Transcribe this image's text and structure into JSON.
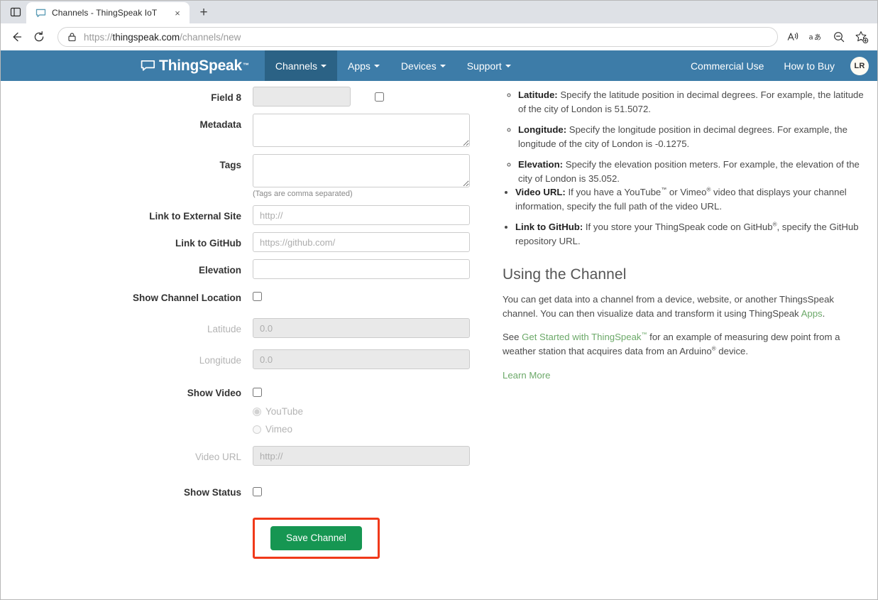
{
  "browser": {
    "tab": {
      "title": "Channels - ThingSpeak IoT",
      "favicon_icon": "speech-bubble-icon",
      "close_icon": "×"
    },
    "tab_list_icon": "tab-list-icon",
    "new_tab_icon": "+",
    "back_icon": "←",
    "reload_icon": "⟳",
    "lock_icon": "lock-icon",
    "url": {
      "scheme": "https://",
      "host": "thingspeak.com",
      "path": "/channels/new",
      "full": "https://thingspeak.com/channels/new"
    },
    "right_icons": [
      {
        "name": "read-aloud-icon",
        "glyph": "Aᶻ"
      },
      {
        "name": "translate-icon",
        "glyph": "aあ"
      },
      {
        "name": "zoom-out-icon",
        "glyph": "⊖"
      },
      {
        "name": "add-favorite-icon",
        "glyph": "☆"
      }
    ]
  },
  "header": {
    "brand": "ThingSpeak",
    "brand_tm": "™",
    "brand_icon": "speech-bubble-icon",
    "nav": [
      {
        "label": "Channels",
        "active": true,
        "caret": true
      },
      {
        "label": "Apps",
        "active": false,
        "caret": true
      },
      {
        "label": "Devices",
        "active": false,
        "caret": true
      },
      {
        "label": "Support",
        "active": false,
        "caret": true
      }
    ],
    "nav_right": [
      {
        "label": "Commercial Use"
      },
      {
        "label": "How to Buy"
      }
    ],
    "avatar_initials": "LR",
    "bg_color": "#3d7ca8",
    "active_bg_color": "#2b6285"
  },
  "form": {
    "field8": {
      "label": "Field 8",
      "value": "",
      "placeholder": "",
      "checkbox_checked": false
    },
    "metadata": {
      "label": "Metadata",
      "value": "",
      "placeholder": ""
    },
    "tags": {
      "label": "Tags",
      "value": "",
      "placeholder": "",
      "help": "(Tags are comma separated)"
    },
    "link_external": {
      "label": "Link to External Site",
      "value": "",
      "placeholder": "http://"
    },
    "link_github": {
      "label": "Link to GitHub",
      "value": "",
      "placeholder": "https://github.com/"
    },
    "elevation": {
      "label": "Elevation",
      "value": "",
      "placeholder": ""
    },
    "show_channel_location": {
      "label": "Show Channel Location",
      "checked": false
    },
    "latitude": {
      "label": "Latitude",
      "value": "0.0",
      "placeholder": "0.0",
      "disabled": true
    },
    "longitude": {
      "label": "Longitude",
      "value": "0.0",
      "placeholder": "0.0",
      "disabled": true
    },
    "show_video": {
      "label": "Show Video",
      "checked": false,
      "options": [
        {
          "label": "YouTube",
          "selected": true
        },
        {
          "label": "Vimeo",
          "selected": false
        }
      ]
    },
    "video_url": {
      "label": "Video URL",
      "value": "",
      "placeholder": "http://",
      "disabled": true
    },
    "show_status": {
      "label": "Show Status",
      "checked": false
    },
    "save_button": {
      "label": "Save Channel",
      "color": "#169652",
      "highlight_color": "#f0391a"
    }
  },
  "doc": {
    "bullets": [
      {
        "term": "Latitude:",
        "text": " Specify the latitude position in decimal degrees. For example, the latitude of the city of London is 51.5072.",
        "sub": true
      },
      {
        "term": "Longitude:",
        "text": " Specify the longitude position in decimal degrees. For example, the longitude of the city of London is -0.1275.",
        "sub": true
      },
      {
        "term": "Elevation:",
        "text": " Specify the elevation position meters. For example, the elevation of the city of London is 35.052.",
        "sub": true
      }
    ],
    "video_url_term": "Video URL:",
    "video_url_text_a": " If you have a YouTube",
    "video_url_tm": "™",
    "video_url_text_b": " or Vimeo",
    "video_url_reg": "®",
    "video_url_text_c": " video that displays your channel information, specify the full path of the video URL.",
    "github_term": "Link to GitHub:",
    "github_text_a": " If you store your ThingSpeak code on GitHub",
    "github_reg": "®",
    "github_text_b": ", specify the GitHub repository URL.",
    "section_title": "Using the Channel",
    "para1_a": "You can get data into a channel from a device, website, or another ThingsSpeak channel. You can then visualize data and transform it using ThingSpeak ",
    "para1_link": "Apps",
    "para1_b": ".",
    "para2_a": "See ",
    "para2_link": "Get Started with ThingSpeak",
    "para2_link_tm": "™",
    "para2_b": " for an example of measuring dew point from a weather station that acquires data from an Arduino",
    "para2_reg": "®",
    "para2_c": " device.",
    "learn_more": "Learn More",
    "link_color": "#6ca969"
  }
}
